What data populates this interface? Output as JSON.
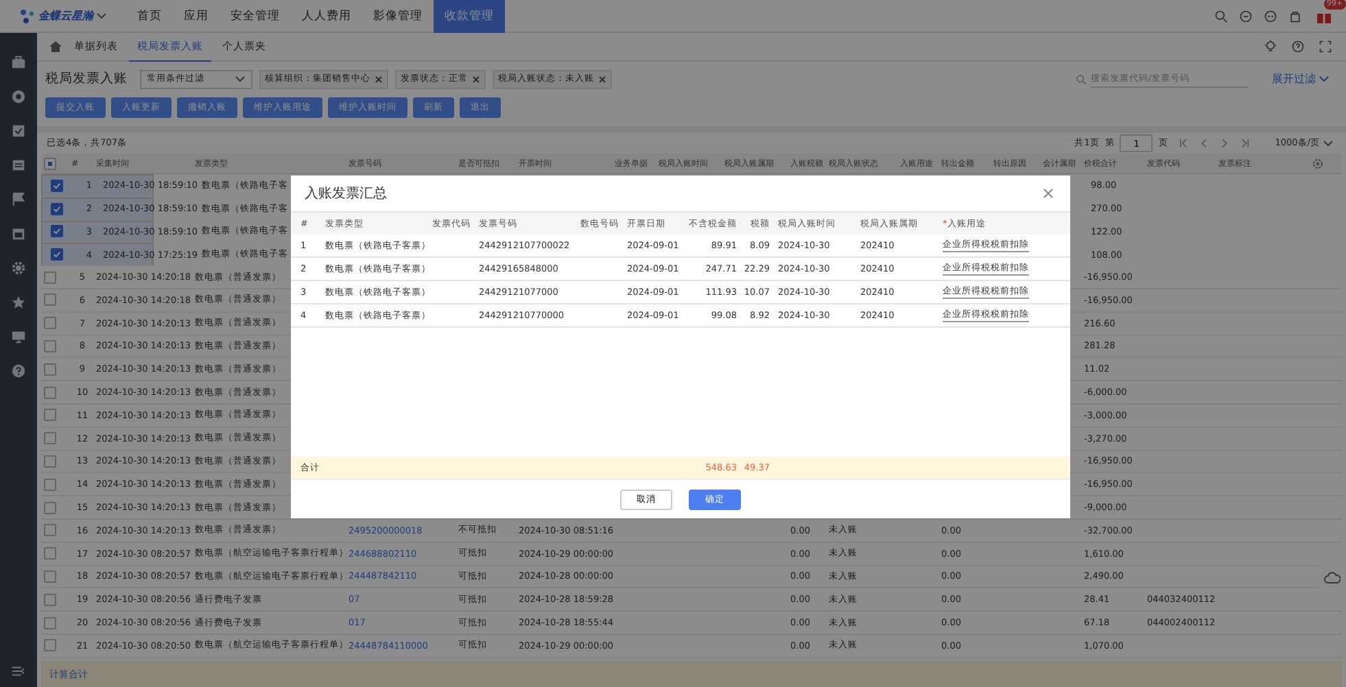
{
  "nav": {
    "logo": "金蝶云星瀚",
    "tabs": [
      {
        "label": "首页",
        "selected": false
      },
      {
        "label": "应用",
        "selected": false
      },
      {
        "label": "安全管理",
        "selected": false
      },
      {
        "label": "人人费用",
        "selected": false
      },
      {
        "label": "影像管理",
        "selected": false
      },
      {
        "label": "收款管理",
        "selected": true
      }
    ],
    "badge": "99+"
  },
  "page_tabs": [
    {
      "label": "单据列表",
      "selected": false
    },
    {
      "label": "税局发票入账",
      "selected": true
    },
    {
      "label": "个人票夹",
      "selected": false
    }
  ],
  "header": {
    "title": "税局发票入账",
    "filter_select": "常用条件过滤",
    "filters": [
      "核算组织：集团销售中心",
      "发票状态：正常",
      "税局入账状态：未入账"
    ],
    "search": {
      "placeholder": "搜索发票代码/发票号码"
    },
    "expand_filter": "展开过滤"
  },
  "buttons": [
    "提交入账",
    "入账更新",
    "撤销入账",
    "维护入账用途",
    "维护入账时间",
    "刷新",
    "退出"
  ],
  "table": {
    "selection_info": "已选4条，共707条",
    "pager": {
      "total_pages": "共1页",
      "page_prefix": "第",
      "page": "1",
      "page_suffix": "页",
      "page_size": "1000条/页"
    },
    "select_all_partial": true,
    "columns": [
      "#",
      "采集时间",
      "发票类型",
      "发票号码",
      "是否可抵扣",
      "开票时间",
      "业务单据",
      "税局入账时间",
      "税局入账属期",
      "入账税额",
      "税局入账状态",
      "入账用途",
      "转出金额",
      "转出原因",
      "会计属期",
      "价税合计",
      "发票代码",
      "发票标注"
    ],
    "rows": [
      {
        "checked": true,
        "no": "1",
        "collected": "2024-10-30 18:59:10",
        "type": "数电票（铁路电子客",
        "total": "98.00"
      },
      {
        "checked": true,
        "no": "2",
        "collected": "2024-10-30 18:59:10",
        "type": "数电票（铁路电子客",
        "total": "270.00"
      },
      {
        "checked": true,
        "no": "3",
        "collected": "2024-10-30 18:59:10",
        "type": "数电票（铁路电子客",
        "total": "122.00"
      },
      {
        "checked": true,
        "no": "4",
        "collected": "2024-10-30 17:25:19",
        "type": "数电票（铁路电子客",
        "total": "108.00"
      },
      {
        "checked": false,
        "no": "5",
        "collected": "2024-10-30 14:20:18",
        "type": "数电票（普通发票）",
        "total": "-16,950.00"
      },
      {
        "checked": false,
        "no": "6",
        "collected": "2024-10-30 14:20:18",
        "type": "数电票（普通发票）",
        "total": "-16,950.00"
      },
      {
        "checked": false,
        "no": "7",
        "collected": "2024-10-30 14:20:13",
        "type": "数电票（普通发票）",
        "total": "216.60"
      },
      {
        "checked": false,
        "no": "8",
        "collected": "2024-10-30 14:20:13",
        "type": "数电票（普通发票）",
        "total": "281.28"
      },
      {
        "checked": false,
        "no": "9",
        "collected": "2024-10-30 14:20:13",
        "type": "数电票（普通发票）",
        "total": "11.02"
      },
      {
        "checked": false,
        "no": "10",
        "collected": "2024-10-30 14:20:13",
        "type": "数电票（普通发票）",
        "total": "-6,000.00"
      },
      {
        "checked": false,
        "no": "11",
        "collected": "2024-10-30 14:20:13",
        "type": "数电票（普通发票）",
        "total": "-3,000.00"
      },
      {
        "checked": false,
        "no": "12",
        "collected": "2024-10-30 14:20:13",
        "type": "数电票（普通发票）",
        "total": "-3,270.00"
      },
      {
        "checked": false,
        "no": "13",
        "collected": "2024-10-30 14:20:13",
        "type": "数电票（普通发票）",
        "total": "-16,950.00"
      },
      {
        "checked": false,
        "no": "14",
        "collected": "2024-10-30 14:20:13",
        "type": "数电票（普通发票）",
        "total": "-16,950.00"
      },
      {
        "checked": false,
        "no": "15",
        "collected": "2024-10-30 14:20:13",
        "type": "数电票（普通发票）",
        "total": "-9,000.00"
      },
      {
        "checked": false,
        "no": "16",
        "collected": "2024-10-30 14:20:13",
        "type": "数电票（普通发票）",
        "invoice_no": "2495200000018",
        "deductible": "不可抵扣",
        "issued": "2024-10-30 08:51:16",
        "tax_amount": "0.00",
        "tax_status": "未入账",
        "out_amount": "0.00",
        "total": "-32,700.00"
      },
      {
        "checked": false,
        "no": "17",
        "collected": "2024-10-30 08:20:57",
        "type": "数电票（航空运输电子客票行程单）",
        "invoice_no": "244688802110",
        "deductible": "可抵扣",
        "issued": "2024-10-29 00:00:00",
        "tax_amount": "0.00",
        "tax_status": "未入账",
        "out_amount": "0.00",
        "total": "1,610.00"
      },
      {
        "checked": false,
        "no": "18",
        "collected": "2024-10-30 08:20:57",
        "type": "数电票（航空运输电子客票行程单）",
        "invoice_no": "244487842110",
        "deductible": "可抵扣",
        "issued": "2024-10-28 00:00:00",
        "tax_amount": "0.00",
        "tax_status": "未入账",
        "out_amount": "0.00",
        "total": "2,490.00"
      },
      {
        "checked": false,
        "no": "19",
        "collected": "2024-10-30 08:20:56",
        "type": "通行费电子发票",
        "invoice_no": "07",
        "deductible": "可抵扣",
        "issued": "2024-10-28 18:59:28",
        "tax_amount": "0.00",
        "tax_status": "未入账",
        "out_amount": "0.00",
        "total": "28.41",
        "code": "044032400112"
      },
      {
        "checked": false,
        "no": "20",
        "collected": "2024-10-30 08:20:56",
        "type": "通行费电子发票",
        "invoice_no": "017",
        "deductible": "可抵扣",
        "issued": "2024-10-28 18:55:44",
        "tax_amount": "0.00",
        "tax_status": "未入账",
        "out_amount": "0.00",
        "total": "67.18",
        "code": "044002400112"
      },
      {
        "checked": false,
        "no": "21",
        "collected": "2024-10-30 08:20:50",
        "type": "数电票（航空运输电子客票行程单）",
        "invoice_no": "24448784110000",
        "deductible": "可抵扣",
        "issued": "2024-10-29 00:00:00",
        "tax_amount": "0.00",
        "tax_status": "未入账",
        "out_amount": "0.00",
        "total": "1,070.00"
      }
    ],
    "footer_link": "计算合计"
  },
  "dialog": {
    "title": "入账发票汇总",
    "columns": [
      "#",
      "发票类型",
      "发票代码",
      "发票号码",
      "数电号码",
      "开票日期",
      "不含税金额",
      "税额",
      "税局入账时间",
      "税局入账属期",
      "入账用途"
    ],
    "required_mark": "*",
    "rows": [
      {
        "no": "1",
        "type": "数电票（铁路电子客票）",
        "invoice_no": "2442912107700022",
        "date": "2024-09-01",
        "amount": "89.91",
        "tax": "8.09",
        "tax_time": "2024-10-30",
        "period": "202410",
        "purpose": "企业所得税税前扣除"
      },
      {
        "no": "2",
        "type": "数电票（铁路电子客票）",
        "invoice_no": "24429165848000",
        "date": "2024-09-01",
        "amount": "247.71",
        "tax": "22.29",
        "tax_time": "2024-10-30",
        "period": "202410",
        "purpose": "企业所得税税前扣除"
      },
      {
        "no": "3",
        "type": "数电票（铁路电子客票）",
        "invoice_no": "24429121077000",
        "date": "2024-09-01",
        "amount": "111.93",
        "tax": "10.07",
        "tax_time": "2024-10-30",
        "period": "202410",
        "purpose": "企业所得税税前扣除"
      },
      {
        "no": "4",
        "type": "数电票（铁路电子客票）",
        "invoice_no": "244291210770000",
        "date": "2024-09-01",
        "amount": "99.08",
        "tax": "8.92",
        "tax_time": "2024-10-30",
        "period": "202410",
        "purpose": "企业所得税税前扣除"
      }
    ],
    "total_label": "合计",
    "total_amount": "548.63",
    "total_tax": "49.37",
    "cancel": "取消",
    "confirm": "确定"
  }
}
